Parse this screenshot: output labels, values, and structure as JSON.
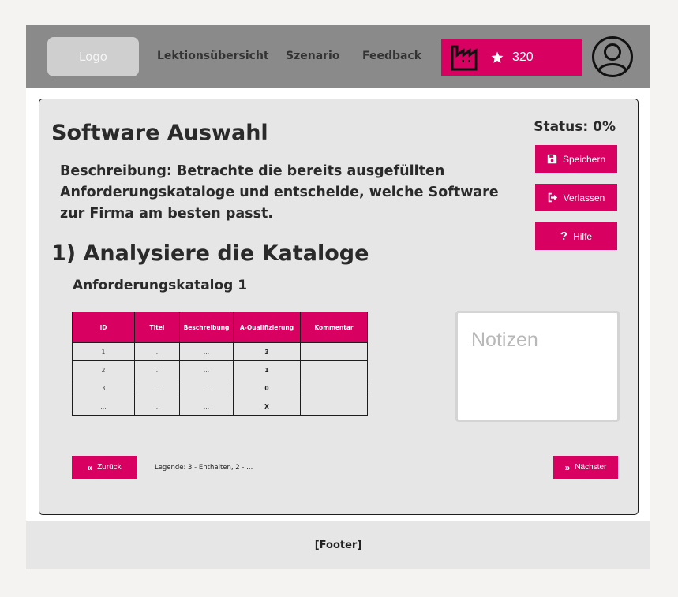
{
  "navbar": {
    "logo": "Logo",
    "links": [
      "Lektionsübersicht",
      "Szenario",
      "Feedback"
    ],
    "points": "320",
    "icons": {
      "factory": "factory-icon",
      "star": "star-icon",
      "avatar": "user-avatar-icon"
    }
  },
  "page": {
    "title": "Software Auswahl",
    "status": "Status: 0%",
    "description": "Beschreibung: Betrachte die bereits ausgefüllten Anforderungskataloge und entscheide, welche Software zur Firma am besten passt.",
    "section_title": "1) Analysiere die Kataloge",
    "subsection_title": "Anforderungskatalog 1"
  },
  "actions": {
    "save": "Speichern",
    "leave": "Verlassen",
    "help": "Hilfe"
  },
  "table": {
    "headers": [
      "ID",
      "Titel",
      "Beschreibung",
      "A-Qualifizierung",
      "Kommentar"
    ],
    "rows": [
      [
        "1",
        "...",
        "...",
        "3",
        ""
      ],
      [
        "2",
        "...",
        "...",
        "1",
        ""
      ],
      [
        "3",
        "...",
        "...",
        "0",
        ""
      ],
      [
        "...",
        "...",
        "...",
        "X",
        ""
      ]
    ]
  },
  "notes": {
    "placeholder": "Notizen"
  },
  "pagination": {
    "back": "Zurück",
    "next": "Nächster",
    "legend": "Legende: 3 - Enthalten, 2 - ..."
  },
  "footer": {
    "text": "[Footer]"
  },
  "colors": {
    "accent": "#d80061",
    "navbar": "#8a8a8a",
    "card": "#e6e6e6"
  }
}
